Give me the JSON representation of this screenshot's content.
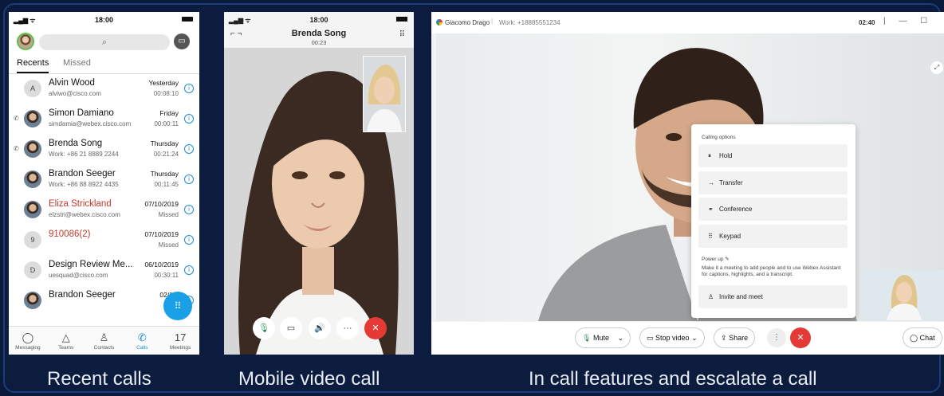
{
  "recents_panel": {
    "status_time": "18:00",
    "search_icon": "search-icon",
    "tabs": [
      "Recents",
      "Missed"
    ],
    "rows": [
      {
        "initial": "A",
        "name": "Alvin Wood",
        "sub": "alviwo@cisco.com",
        "date": "Yesterday",
        "dur": "00:08:10",
        "red": false,
        "photo": false,
        "mark": ""
      },
      {
        "initial": "",
        "name": "Simon Damiano",
        "sub": "simdamia@webex.cisco.com",
        "date": "Friday",
        "dur": "00:00:11",
        "red": false,
        "photo": true,
        "mark": "✆"
      },
      {
        "initial": "",
        "name": "Brenda Song",
        "sub": "Work: +86 21 8889 2244",
        "date": "Thursday",
        "dur": "00:21:24",
        "red": false,
        "photo": true,
        "mark": "✆"
      },
      {
        "initial": "",
        "name": "Brandon Seeger",
        "sub": "Work: +86 88 8922 4435",
        "date": "Thursday",
        "dur": "00:11:45",
        "red": false,
        "photo": true,
        "mark": ""
      },
      {
        "initial": "",
        "name": "Eliza Strickland",
        "sub": "elzstri@webex.cisco.com",
        "date": "07/10/2019",
        "dur": "Missed",
        "red": true,
        "photo": true,
        "mark": ""
      },
      {
        "initial": "9",
        "name": "910086(2)",
        "sub": "",
        "date": "07/10/2019",
        "dur": "Missed",
        "red": true,
        "photo": false,
        "mark": ""
      },
      {
        "initial": "D",
        "name": "Design Review Me...",
        "sub": "uesquad@cisco.com",
        "date": "06/10/2019",
        "dur": "00:30:11",
        "red": false,
        "photo": false,
        "mark": ""
      },
      {
        "initial": "",
        "name": "Brandon Seeger",
        "sub": "",
        "date": "02/10/",
        "dur": "00:",
        "red": false,
        "photo": true,
        "mark": ""
      }
    ],
    "nav": [
      {
        "label": "Messaging",
        "icon": "◯"
      },
      {
        "label": "Teams",
        "icon": "△"
      },
      {
        "label": "Contacts",
        "icon": "♙"
      },
      {
        "label": "Calls",
        "icon": "✆"
      },
      {
        "label": "Meetings",
        "icon": "17"
      }
    ],
    "active_nav": "Calls"
  },
  "video_panel": {
    "status_time": "18:00",
    "caller": "Brenda Song",
    "duration": "00:23"
  },
  "desktop_panel": {
    "caller": "Giacomo Drago",
    "work": "Work: +18885551234",
    "call_time": "02:40",
    "menu_title": "Calling options",
    "menu_items": [
      {
        "icon": "⏸",
        "label": "Hold"
      },
      {
        "icon": "→",
        "label": "Transfer"
      },
      {
        "icon": "⚭",
        "label": "Conference"
      },
      {
        "icon": "⠿",
        "label": "Keypad"
      }
    ],
    "power_up": "Power up",
    "power_desc": "Make it a meeting to add people and to use Webex Assistant for captions, highlights, and a transcript.",
    "invite": "Invite and meet",
    "controls": {
      "mute": "Mute",
      "stop_video": "Stop video",
      "share": "Share",
      "chat": "Chat"
    }
  },
  "captions": [
    "Recent calls",
    "Mobile video call",
    "In call features and escalate a call"
  ],
  "colors": {
    "background": "#0a1a3a",
    "accent": "#1d8bd6",
    "hangup": "#e53935",
    "missed": "#c0392b"
  }
}
